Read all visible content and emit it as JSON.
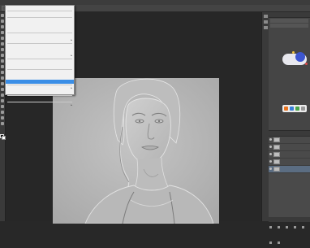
{
  "menubar": {
    "items": [
      "",
      "",
      "",
      "",
      "",
      "",
      "",
      "",
      "",
      "",
      ""
    ]
  },
  "document": {
    "tab_label": ""
  },
  "context_menu": {
    "items": [
      {
        "label": "",
        "shortcut": "",
        "state": "normal"
      },
      {
        "label": "",
        "shortcut": "",
        "state": "normal"
      },
      {
        "label": "",
        "shortcut": "",
        "state": "normal"
      },
      {
        "label": "",
        "shortcut": "",
        "state": "normal"
      },
      {
        "label": "",
        "shortcut": "",
        "state": "normal"
      },
      {
        "label": "",
        "shortcut": "",
        "state": "normal"
      },
      {
        "label": "",
        "shortcut": "",
        "state": "normal"
      },
      {
        "label": "",
        "shortcut": "",
        "state": "normal"
      },
      {
        "label": "",
        "shortcut": "",
        "state": "normal"
      },
      {
        "label": "",
        "shortcut": "",
        "state": "normal"
      },
      {
        "label": "",
        "shortcut": "",
        "state": "normal"
      },
      {
        "label": "",
        "shortcut": "",
        "state": "normal"
      },
      {
        "label": "",
        "shortcut": "",
        "state": "normal"
      },
      {
        "label": "",
        "shortcut": "",
        "state": "normal"
      },
      {
        "label": "",
        "shortcut": "",
        "state": "highlighted"
      },
      {
        "label": "",
        "shortcut": "",
        "state": "normal"
      },
      {
        "label": "",
        "shortcut": "",
        "state": "disabled"
      },
      {
        "label": "",
        "shortcut": "",
        "state": "disabled"
      },
      {
        "label": "",
        "shortcut": "",
        "state": "normal"
      }
    ]
  },
  "layers_panel": {
    "layers": [
      {
        "name": "",
        "effect": ""
      },
      {
        "name": "",
        "effect": ""
      },
      {
        "name": "",
        "effect": ""
      },
      {
        "name": "",
        "effect": ""
      },
      {
        "name": "",
        "effect": ""
      }
    ],
    "active_index": 4
  },
  "colors": {
    "menu_highlight": "#3a8ee6",
    "badge_blue": "#3d56d0",
    "canvas_gray": "#b9b9b9"
  }
}
